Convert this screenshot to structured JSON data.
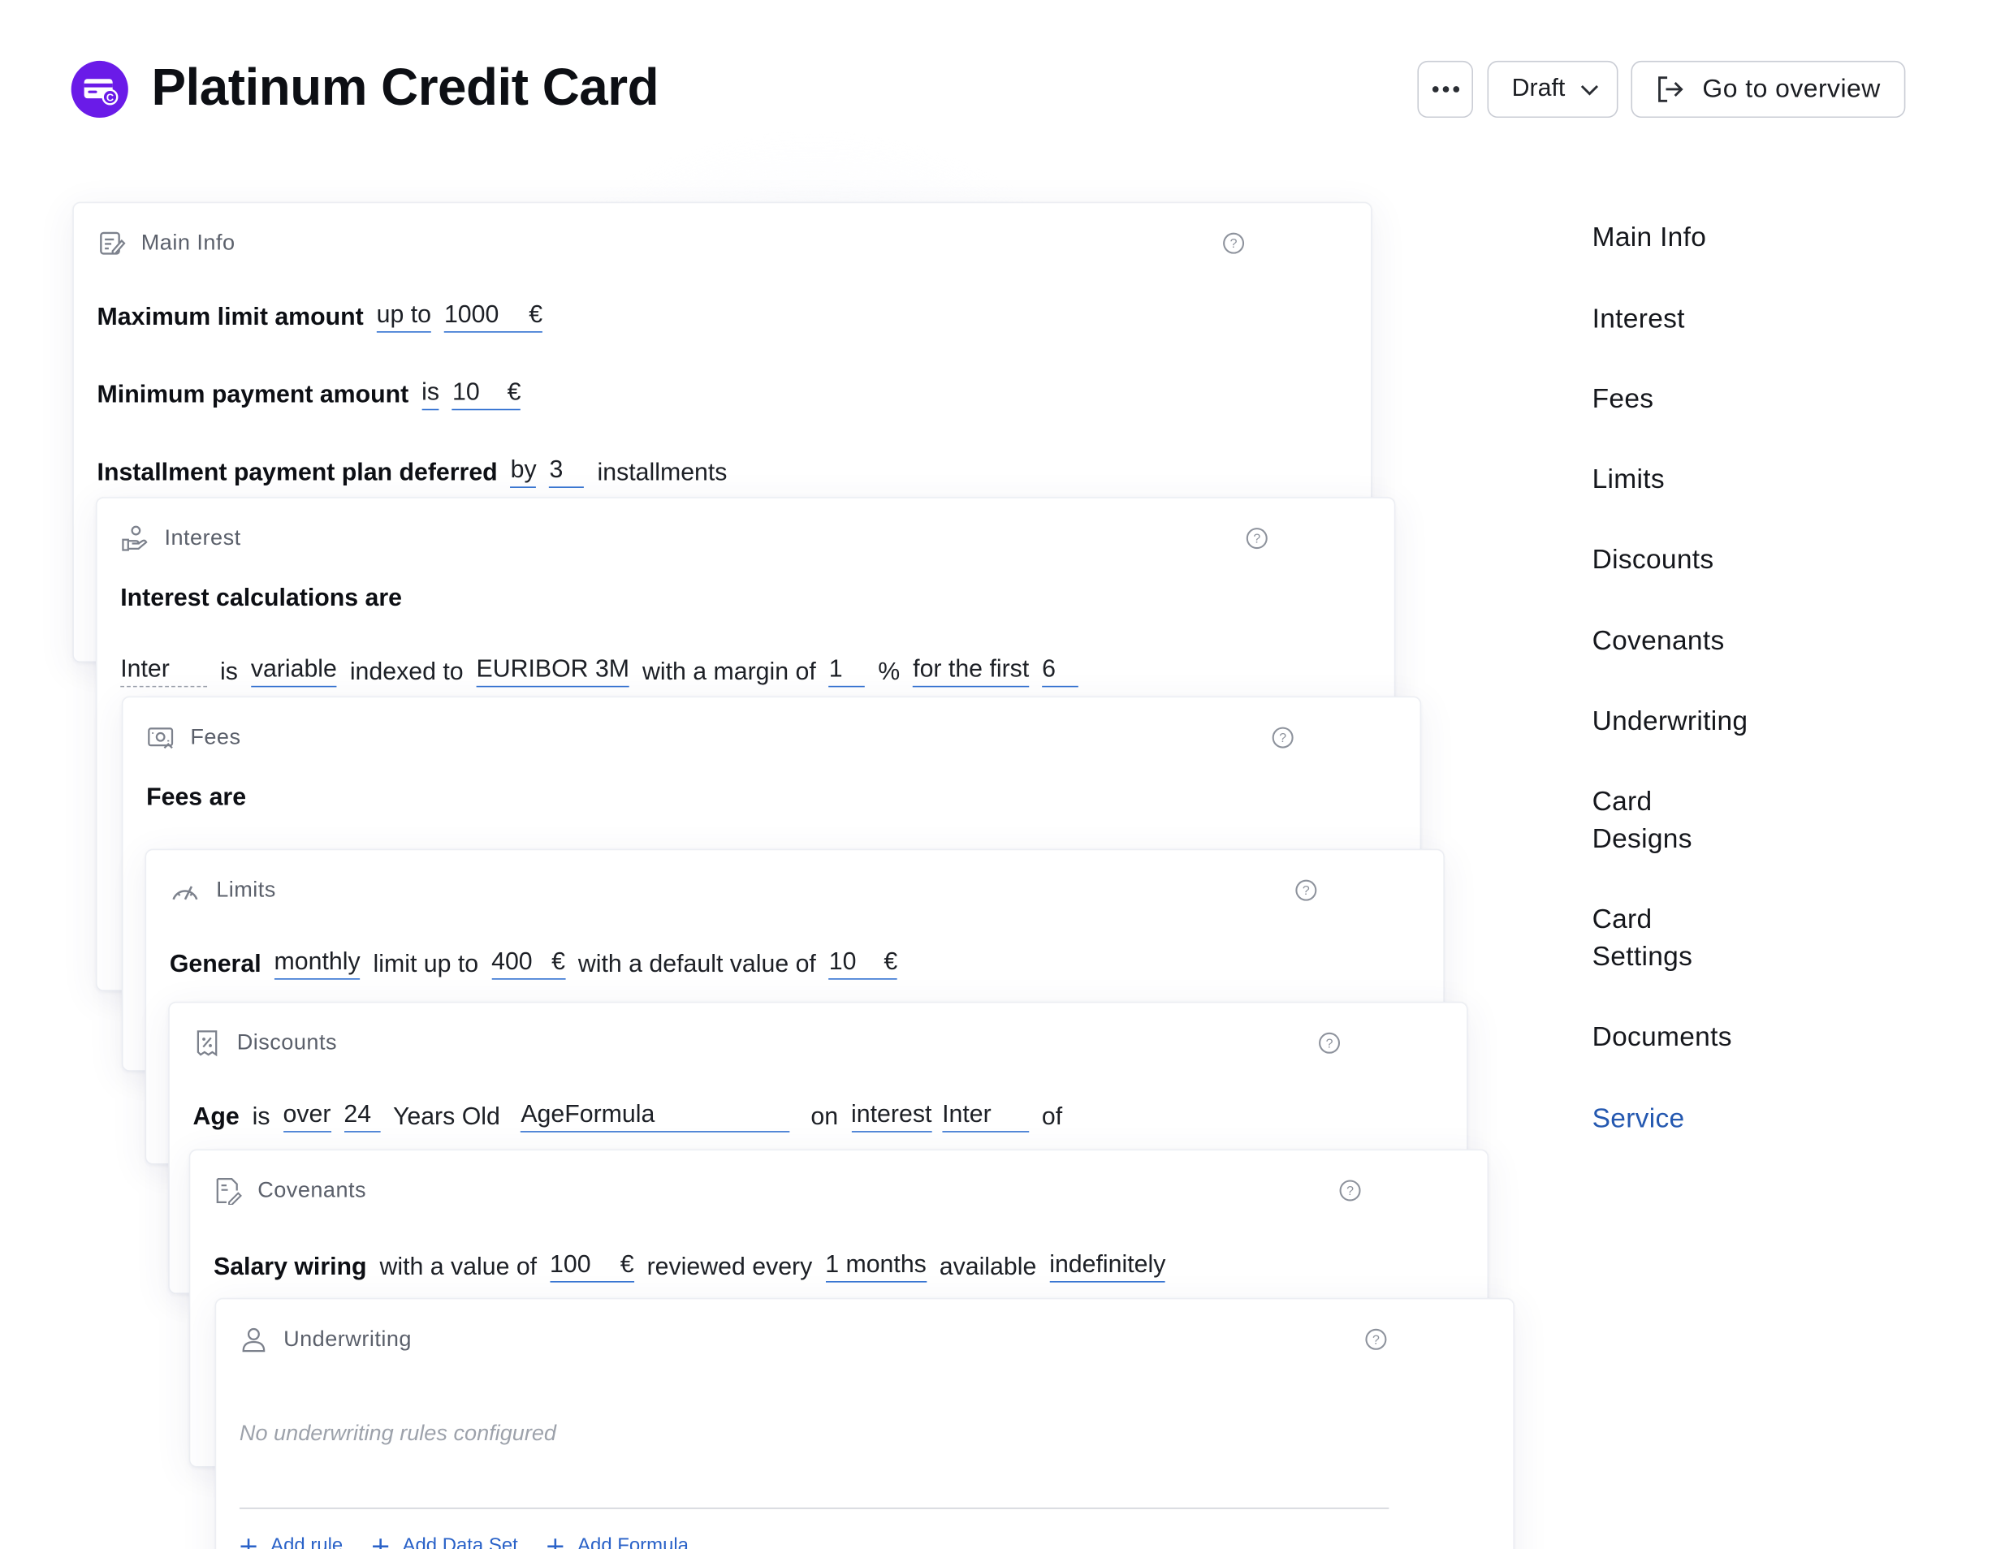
{
  "header": {
    "title": "Platinum Credit Card",
    "status": "Draft",
    "overview_label": "Go to overview"
  },
  "cards": {
    "main_info": {
      "title": "Main Info",
      "max_limit": {
        "label": "Maximum limit amount",
        "operator": "up to",
        "value": "1000",
        "unit": "€"
      },
      "min_payment": {
        "label": "Minimum payment amount",
        "operator": "is",
        "value": "10",
        "unit": "€"
      },
      "installment": {
        "label": "Installment payment plan deferred",
        "operator": "by",
        "value": "3",
        "suffix": "installments"
      }
    },
    "interest": {
      "title": "Interest",
      "heading": "Interest calculations are",
      "name": "Inter",
      "is": "is",
      "type": "variable",
      "indexed_to": "indexed to",
      "index": "EURIBOR 3M",
      "margin_label": "with a margin of",
      "margin": "1",
      "percent": "%",
      "period_label": "for the first",
      "period": "6"
    },
    "fees": {
      "title": "Fees",
      "heading": "Fees are"
    },
    "limits": {
      "title": "Limits",
      "label": "General",
      "frequency": "monthly",
      "limit_label": "limit up to",
      "limit_value": "400",
      "unit": "€",
      "default_label": "with a default value of",
      "default_value": "10"
    },
    "discounts": {
      "title": "Discounts",
      "label": "Age",
      "is": "is",
      "comparator": "over",
      "age": "24",
      "age_unit": "Years Old",
      "formula": "AgeFormula",
      "on": "on",
      "target": "interest",
      "target_name": "Inter",
      "of": "of"
    },
    "covenants": {
      "title": "Covenants",
      "label": "Salary wiring",
      "value_label": "with a value of",
      "value": "100",
      "unit": "€",
      "review_label": "reviewed every",
      "review_period": "1 months",
      "available_label": "available",
      "availability": "indefinitely"
    },
    "underwriting": {
      "title": "Underwriting",
      "empty": "No underwriting rules configured",
      "actions": [
        "Add rule",
        "Add Data Set",
        "Add Formula"
      ]
    }
  },
  "side_nav": {
    "items": [
      "Main Info",
      "Interest",
      "Fees",
      "Limits",
      "Discounts",
      "Covenants",
      "Underwriting",
      "Card Designs",
      "Card Settings",
      "Documents",
      "Service"
    ],
    "active": "Service"
  },
  "colors": {
    "accent": "#2f6fd0",
    "brand": "#6a1be8",
    "active_nav": "#2458b0"
  },
  "icons": [
    "credit-card-icon",
    "more-icon",
    "chevron-down-icon",
    "exit-icon",
    "edit-note-icon",
    "hand-coins-icon",
    "receipt-icon",
    "gauge-icon",
    "discount-tag-icon",
    "contract-icon",
    "user-icon",
    "help-icon",
    "plus-icon"
  ]
}
